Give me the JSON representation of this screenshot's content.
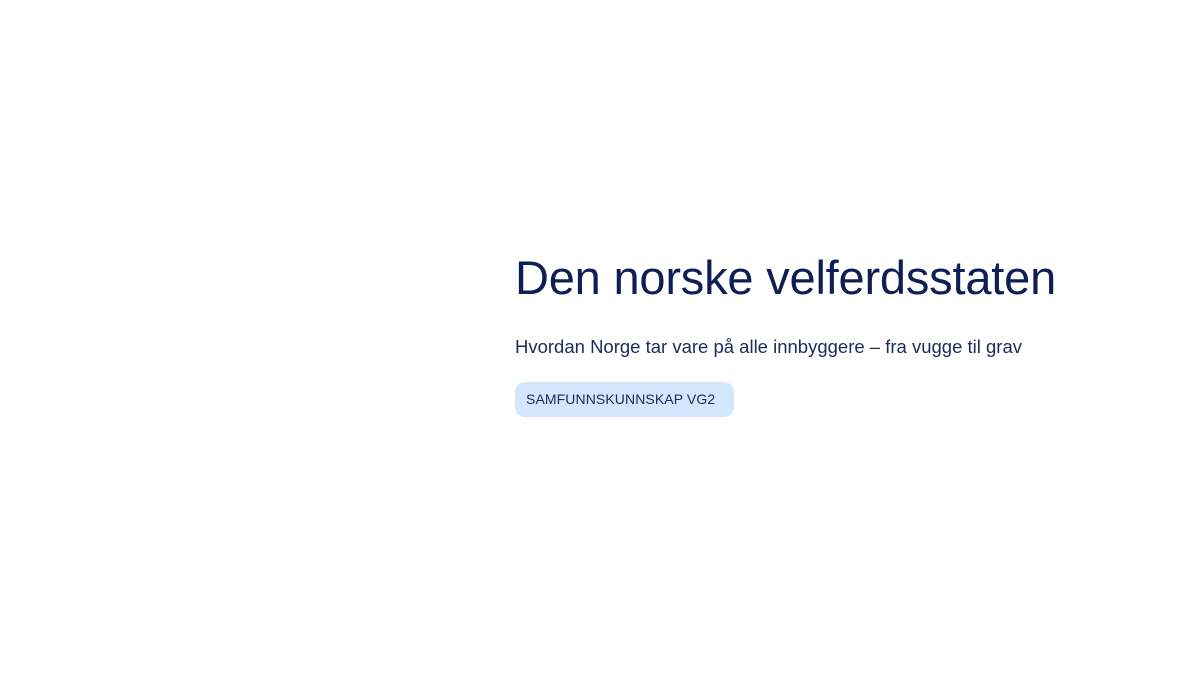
{
  "slide": {
    "title": "Den norske velferdsstaten",
    "subtitle": "Hvordan Norge tar vare på alle innbyggere – fra vugge til grav",
    "tag": "SAMFUNNSKUNNSKAP VG2"
  },
  "colors": {
    "background": "#ffffff",
    "title": "#0f1f55",
    "subtitle": "#1c2b5c",
    "tag_background": "#d3e6fb",
    "tag_text": "#1c2b5c"
  }
}
